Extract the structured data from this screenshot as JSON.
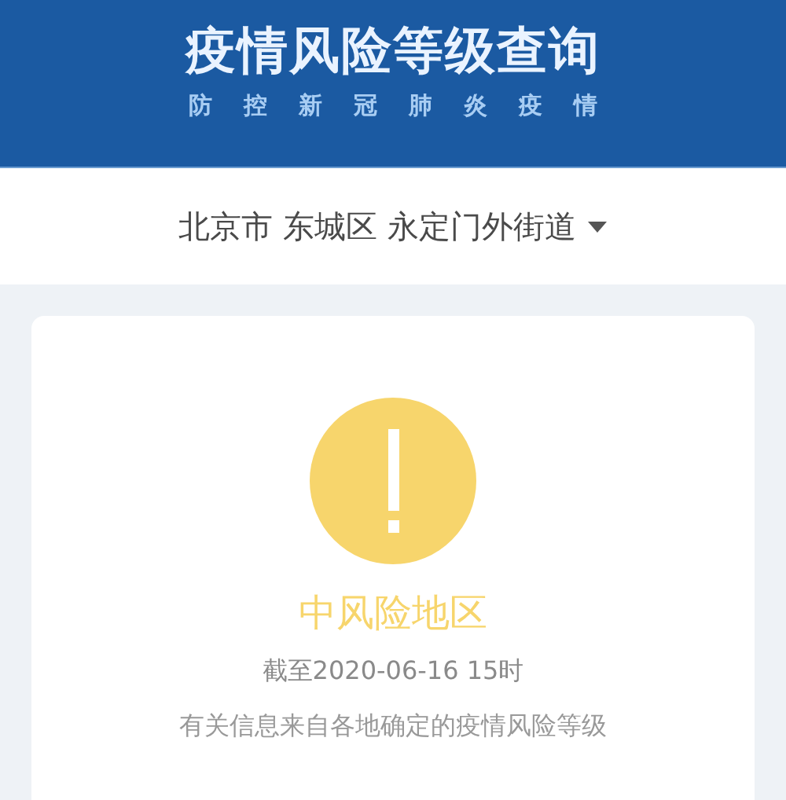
{
  "header": {
    "title": "疫情风险等级查询",
    "subtitle": "防控新冠肺炎疫情"
  },
  "location": {
    "label": "北京市 东城区 永定门外街道"
  },
  "result": {
    "kind": "medium",
    "label": "中风险地区",
    "updated": "截至2020-06-16 15时",
    "note": "有关信息来自各地确定的疫情风险等级"
  }
}
